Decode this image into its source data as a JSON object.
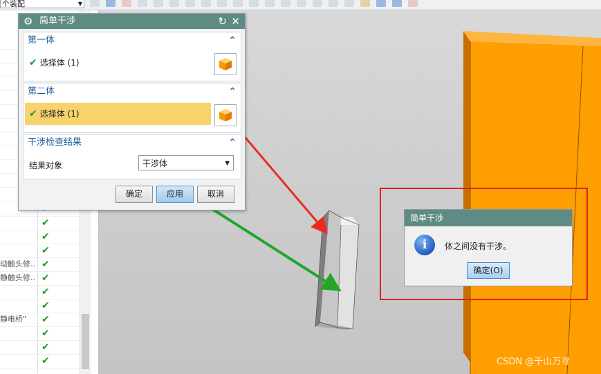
{
  "toolbar": {
    "assembly_filter": "个装配"
  },
  "main_dialog": {
    "title": "简单干涉",
    "first_body": {
      "header": "第一体",
      "select_label": "选择体 (1)"
    },
    "second_body": {
      "header": "第二体",
      "select_label": "选择体 (1)"
    },
    "result": {
      "header": "干涉检查结果",
      "object_label": "结果对象",
      "object_value": "干涉体"
    },
    "buttons": {
      "ok": "确定",
      "apply": "应用",
      "cancel": "取消"
    }
  },
  "navigator_rows": [
    {
      "text": "",
      "checked": true
    },
    {
      "text": "",
      "checked": true
    },
    {
      "text": "",
      "checked": true
    },
    {
      "text": "",
      "checked": true
    },
    {
      "text": "动触头修...",
      "checked": true
    },
    {
      "text": "静触头修...",
      "checked": true
    },
    {
      "text": "",
      "checked": true
    },
    {
      "text": "",
      "checked": true
    },
    {
      "text": "静电桥\"",
      "checked": true
    },
    {
      "text": "",
      "checked": true
    },
    {
      "text": "",
      "checked": true
    },
    {
      "text": "",
      "checked": true
    }
  ],
  "message_box": {
    "title": "简单干涉",
    "text": "体之间没有干涉。",
    "ok": "确定(O)"
  },
  "watermark": "CSDN @千山万寻",
  "colors": {
    "title_bar": "#5e8c85",
    "active_selection": "#f7d36b",
    "part_orange": "#ff9e00",
    "arrow_red": "#ee2a1f",
    "arrow_green": "#22a52a",
    "highlight_box": "#e02020"
  }
}
